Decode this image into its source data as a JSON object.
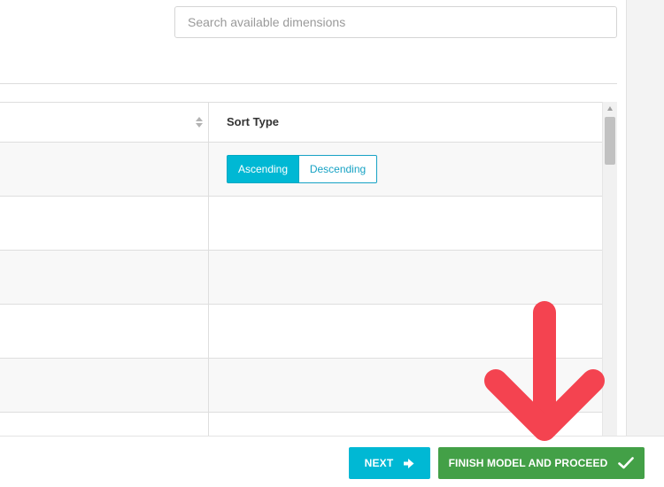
{
  "search": {
    "placeholder": "Search available dimensions",
    "value": ""
  },
  "table": {
    "headers": {
      "left": "",
      "right": "Sort Type"
    },
    "sort_options": {
      "ascending": "Ascending",
      "descending": "Descending",
      "selected": "Ascending"
    },
    "row_count_visible": 6
  },
  "footer": {
    "next_label": "NEXT",
    "finish_label": "FINISH MODEL AND PROCEED"
  },
  "icons": {
    "sort": "sort-icon",
    "next": "arrow-right-icon",
    "finish": "checkmark-icon",
    "annotation": "down-arrow-annotation-icon"
  },
  "colors": {
    "primary": "#00b8d4",
    "success": "#43a047",
    "annotation": "#f44350"
  }
}
